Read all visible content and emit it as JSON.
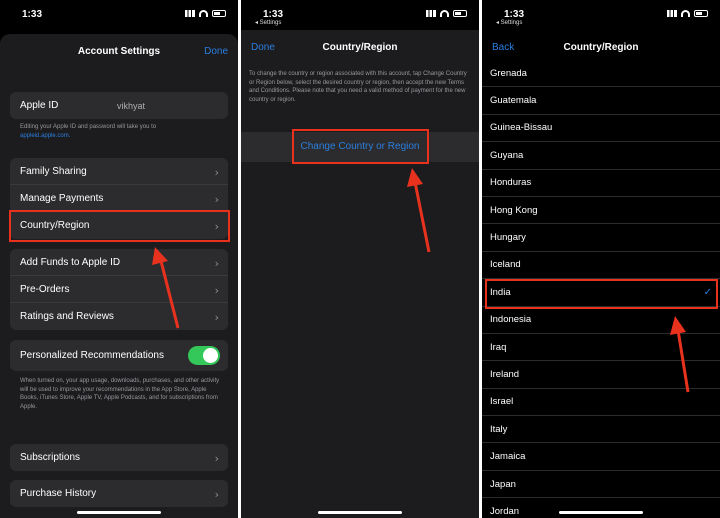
{
  "status_time": "1:33",
  "back_app": "◂ Settings",
  "panel1": {
    "title": "Account Settings",
    "done": "Done",
    "apple_id_label": "Apple ID",
    "apple_id_value": "vikhyat",
    "apple_id_note": "Editing your Apple ID and password will take you to",
    "apple_id_link": "appleid.apple.com.",
    "rows_a": [
      "Family Sharing",
      "Manage Payments",
      "Country/Region"
    ],
    "rows_b": [
      "Add Funds to Apple ID",
      "Pre-Orders",
      "Ratings and Reviews"
    ],
    "personalized_label": "Personalized Recommendations",
    "personalized_on": true,
    "personalized_note": "When turned on, your app usage, downloads, purchases, and other activity will be used to improve your recommendations in the App Store, Apple Books, iTunes Store, Apple TV, Apple Podcasts, and for subscriptions from Apple.",
    "subscriptions": "Subscriptions",
    "purchase_history": "Purchase History"
  },
  "panel2": {
    "title": "Country/Region",
    "done": "Done",
    "description": "To change the country or region associated with this account, tap Change Country or Region below, select the desired country or region, then accept the new Terms and Conditions. Please note that you need a valid method of payment for the new country or region.",
    "change_button": "Change Country or Region"
  },
  "panel3": {
    "title": "Country/Region",
    "back": "Back",
    "countries": [
      "Grenada",
      "Guatemala",
      "Guinea-Bissau",
      "Guyana",
      "Honduras",
      "Hong Kong",
      "Hungary",
      "Iceland",
      "India",
      "Indonesia",
      "Iraq",
      "Ireland",
      "Israel",
      "Italy",
      "Jamaica",
      "Japan",
      "Jordan"
    ],
    "selected": "India"
  },
  "colors": {
    "accent": "#2b7fe0",
    "highlight": "#e8321e",
    "toggle_on": "#34c759"
  }
}
